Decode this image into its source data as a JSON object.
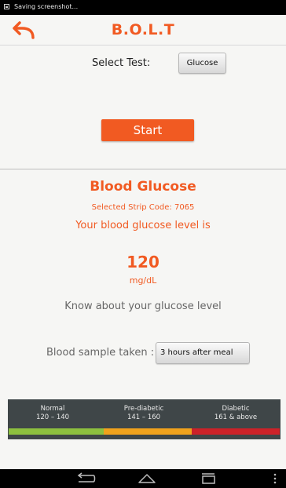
{
  "status_bar": {
    "notification": "Saving screenshot..."
  },
  "app_bar": {
    "title": "B.O.L.T",
    "accent_color": "#f15a22"
  },
  "test_selection": {
    "label": "Select Test:",
    "selected": "Glucose"
  },
  "start_button": {
    "label": "Start"
  },
  "result": {
    "title": "Blood Glucose",
    "strip_code_text": "Selected Strip Code: 7065",
    "level_text": "Your blood glucose level is",
    "value": "120",
    "unit": "mg/dL",
    "know_text": "Know about your glucose level"
  },
  "sample": {
    "label": "Blood sample taken :",
    "selected": "3 hours after meal"
  },
  "ranges": [
    {
      "name": "Normal",
      "range": "120 – 140",
      "color": "#8dc03f"
    },
    {
      "name": "Pre-diabetic",
      "range": "141 – 160",
      "color": "#f0a21c"
    },
    {
      "name": "Diabetic",
      "range": "161 & above",
      "color": "#cc2229"
    }
  ],
  "nav_bar": {
    "icons": [
      "back-icon",
      "home-icon",
      "recent-apps-icon",
      "overflow-menu-icon"
    ]
  }
}
